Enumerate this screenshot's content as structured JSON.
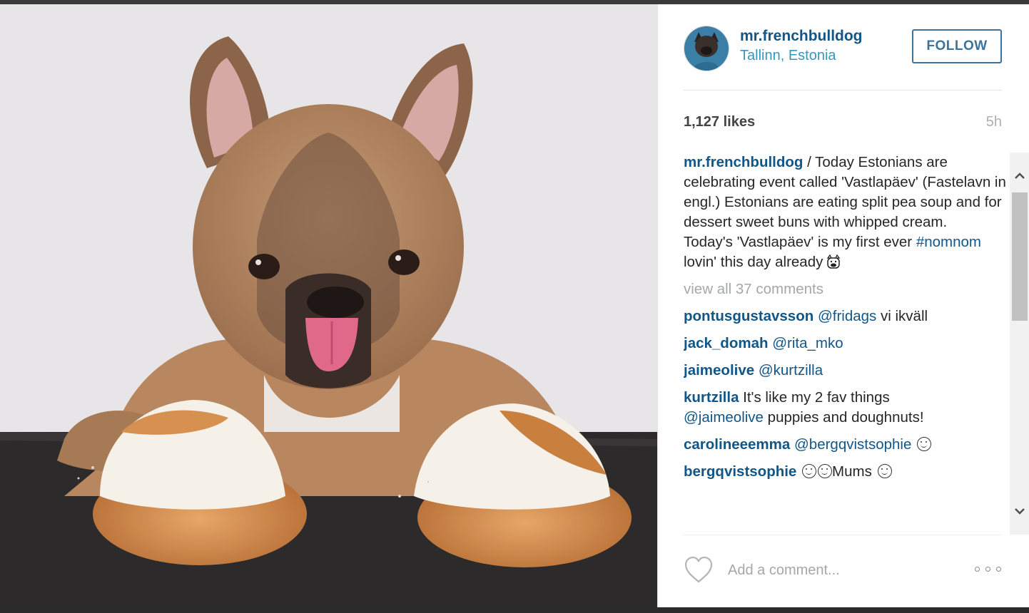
{
  "post": {
    "username": "mr.frenchbulldog",
    "location": "Tallinn, Estonia",
    "follow_label": "FOLLOW",
    "likes": "1,127 likes",
    "time": "5h"
  },
  "caption": {
    "username": "mr.frenchbulldog",
    "text_1": " / Today Estonians are celebrating event called 'Vastlapäev' (Fastelavn in engl.) Estonians are eating split pea soup and for dessert sweet buns with whipped cream.",
    "text_2": "Today's 'Vastlapäev' is my first ever ",
    "hashtag": "#nomnom",
    "text_3": " lovin' this day already"
  },
  "view_all": "view all 37 comments",
  "comments": [
    {
      "user": "pontusgustavsson",
      "mention": "@fridags",
      "text": " vi ikväll"
    },
    {
      "user": "jack_domah",
      "mention": "@rita_mko",
      "text": ""
    },
    {
      "user": "jaimeolive",
      "mention": "@kurtzilla",
      "text": ""
    },
    {
      "user": "kurtzilla",
      "text_before": " It's like my 2 fav things ",
      "mention": "@jaimeolive",
      "text": " puppies and doughnuts!"
    },
    {
      "user": "carolineeemma",
      "mention": "@bergqvistsophie",
      "text": " "
    },
    {
      "user": "bergqvistsophie",
      "text": "Mums "
    }
  ],
  "footer": {
    "comment_placeholder": "Add a comment..."
  },
  "icons": {
    "heart": "heart-icon",
    "more": "more-options-icon",
    "scroll_up": "chevron-up-icon",
    "scroll_down": "chevron-down-icon"
  },
  "colors": {
    "link": "#125688",
    "location": "#3897b9",
    "follow": "#3f729b",
    "muted": "#a5a7aa"
  }
}
